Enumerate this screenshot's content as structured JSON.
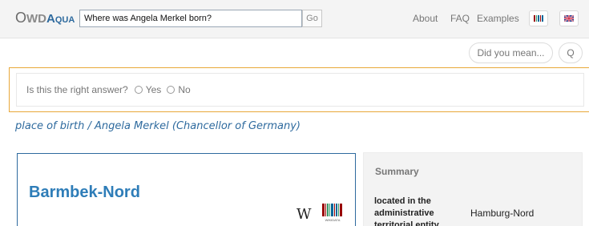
{
  "navbar": {
    "logo": {
      "o": "O",
      "wd": "WD",
      "aqua": "Aqua"
    },
    "search": {
      "value": "Where was Angela Merkel born?"
    },
    "go_label": "Go",
    "links": {
      "about": "About",
      "faq": "FAQ",
      "examples": "Examples"
    },
    "flags": [
      "wikidata-flag-icon",
      "uk-flag-icon"
    ]
  },
  "suggestions": {
    "did_you_mean": "Did you mean...",
    "q": "Q"
  },
  "feedback": {
    "question": "Is this the right answer?",
    "yes": "Yes",
    "no": "No",
    "accent": "#e8a839"
  },
  "result": {
    "path": "place of birth / Angela Merkel (Chancellor of Germany)",
    "title": "Barmbek-Nord",
    "wiki_icon_glyph": "W",
    "wikidata_label": "WIKIDATA"
  },
  "summary": {
    "title": "Summary",
    "rows": [
      {
        "key": "located in the administrative territorial entity",
        "value": "Hamburg-Nord"
      }
    ]
  },
  "colors": {
    "link": "#2e6a9e",
    "title": "#2e7db8",
    "panel": "#f3f3f3"
  }
}
